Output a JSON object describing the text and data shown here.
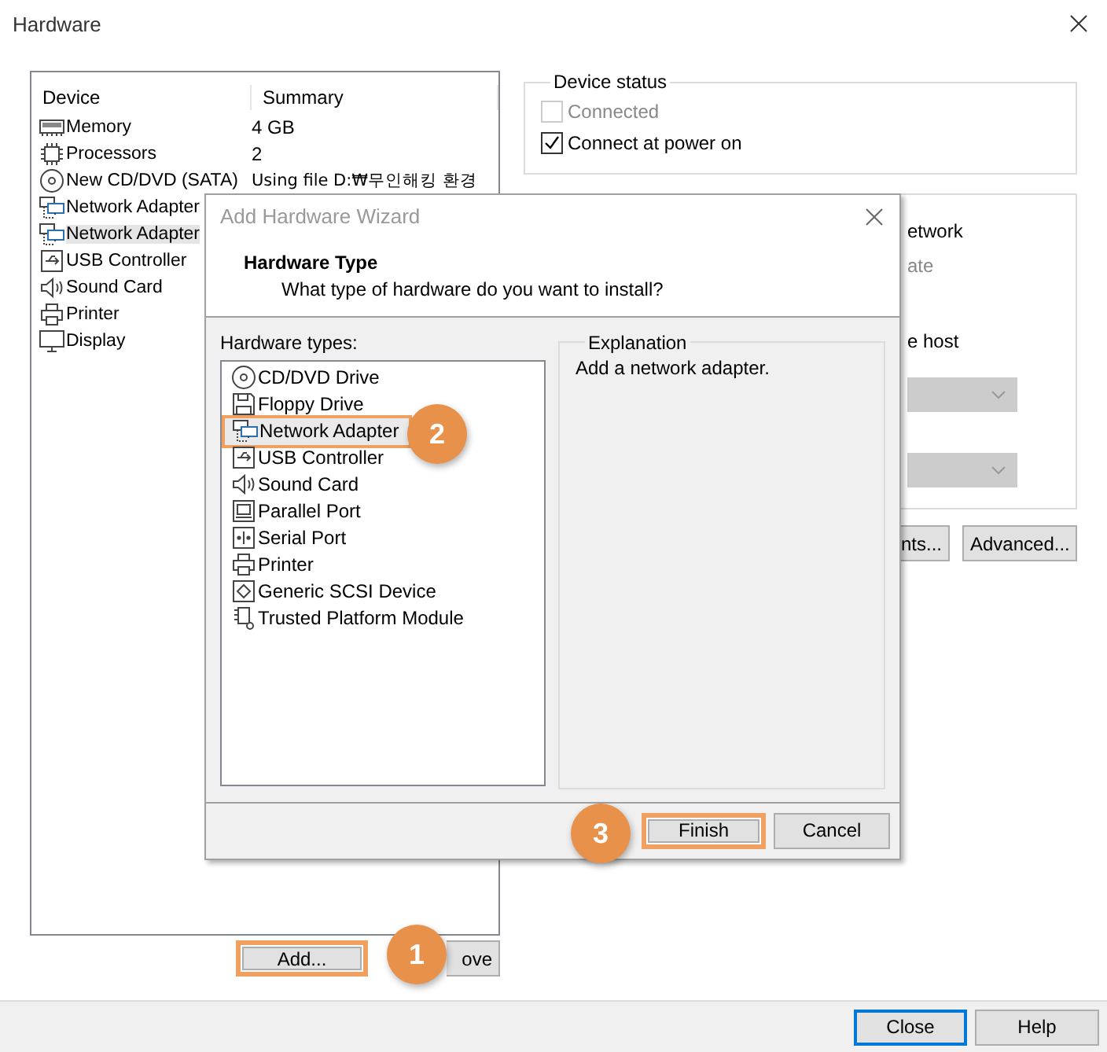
{
  "window": {
    "title": "Hardware"
  },
  "device_table": {
    "columns": [
      "Device",
      "Summary"
    ],
    "rows": [
      {
        "device": "Memory",
        "summary": "4 GB",
        "kind": "memory",
        "selected": false
      },
      {
        "device": "Processors",
        "summary": "2",
        "kind": "cpu",
        "selected": false
      },
      {
        "device": "New CD/DVD (SATA)",
        "summary": "Using file D:₩무인해킹 환경",
        "kind": "disc",
        "selected": false
      },
      {
        "device": "Network Adapter",
        "kind": "network",
        "selected": false
      },
      {
        "device": "Network Adapter",
        "kind": "network",
        "selected": true
      },
      {
        "device": "USB Controller",
        "kind": "usb",
        "selected": false
      },
      {
        "device": "Sound Card",
        "kind": "sound",
        "selected": false
      },
      {
        "device": "Printer",
        "kind": "printer",
        "selected": false
      },
      {
        "device": "Display",
        "kind": "display",
        "selected": false
      }
    ]
  },
  "device_buttons": [
    {
      "label": "Add...",
      "highlighted": true
    },
    {
      "label": "ove",
      "highlighted": false
    }
  ],
  "device_status": {
    "title": "Device status",
    "options": [
      {
        "label": "Connected",
        "checked": false,
        "disabled": true
      },
      {
        "label": "Connect at power on",
        "checked": true,
        "disabled": false
      }
    ]
  },
  "connection": {
    "fragments": [
      {
        "text": "etwork",
        "disabled": false
      },
      {
        "text": "ate",
        "disabled": true
      },
      {
        "text": "e host",
        "disabled": false
      }
    ],
    "buttons": [
      "nts...",
      "Advanced..."
    ]
  },
  "dialog": {
    "title": "Add Hardware Wizard",
    "heading": "Hardware Type",
    "subtitle": "What type of hardware do you want to install?",
    "list_label": "Hardware types:",
    "hardware_types": [
      {
        "label": "CD/DVD Drive",
        "kind": "disc",
        "selected": false,
        "highlighted": false
      },
      {
        "label": "Floppy Drive",
        "kind": "floppy",
        "selected": false,
        "highlighted": false
      },
      {
        "label": "Network Adapter",
        "kind": "network",
        "selected": true,
        "highlighted": true
      },
      {
        "label": "USB Controller",
        "kind": "usb",
        "selected": false,
        "highlighted": false
      },
      {
        "label": "Sound Card",
        "kind": "sound",
        "selected": false,
        "highlighted": false
      },
      {
        "label": "Parallel Port",
        "kind": "parallel",
        "selected": false,
        "highlighted": false
      },
      {
        "label": "Serial Port",
        "kind": "serial",
        "selected": false,
        "highlighted": false
      },
      {
        "label": "Printer",
        "kind": "printer",
        "selected": false,
        "highlighted": false
      },
      {
        "label": "Generic SCSI Device",
        "kind": "scsi",
        "selected": false,
        "highlighted": false
      },
      {
        "label": "Trusted Platform Module",
        "kind": "tpm",
        "selected": false,
        "highlighted": false
      }
    ],
    "explanation": {
      "title": "Explanation",
      "text": "Add a network adapter."
    },
    "buttons": [
      {
        "label": "Finish",
        "highlighted": true
      },
      {
        "label": "Cancel",
        "highlighted": false
      }
    ]
  },
  "footer_buttons": [
    {
      "label": "Close",
      "default": true
    },
    {
      "label": "Help",
      "default": false
    }
  ],
  "annotations": [
    {
      "number": "1"
    },
    {
      "number": "2"
    },
    {
      "number": "3"
    }
  ]
}
